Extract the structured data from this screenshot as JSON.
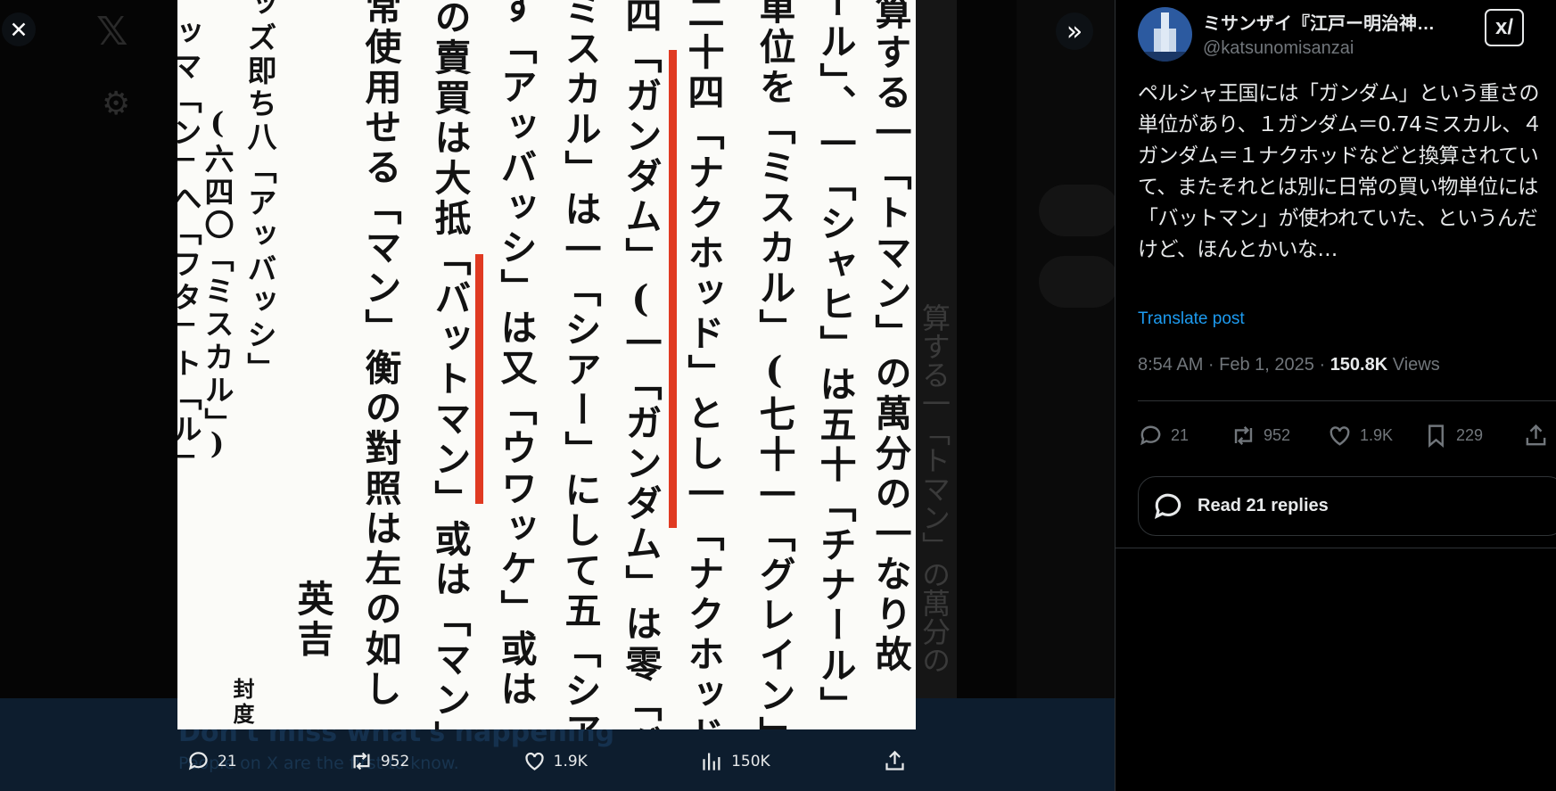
{
  "background_page": {
    "banner_title": "Don't miss what's happening",
    "banner_subtitle": "People on X are the first to know."
  },
  "media": {
    "columns": [
      "算する一「トマン」の萬分の一なり故",
      "ール」、一「シャヒ」は五十「チナール」に",
      "單位を「ミスカル」(七十一「グレイン」)",
      "二十四「ナクホッド」とし一「ナクホッド」",
      "四「ガンダム」(一「ガンダム」は零「グ",
      "ミスカル」は一「シアー」にして五「シア",
      "す「アッバッシ」は又「ウワッケ」或は「カー",
      "の賣買は大抵「バットマン」或は「マン」",
      "常使用せる「マン」衡の對照は左の如し",
      "英吉",
      "ッズ即ち八「アッバッシ」",
      "(六四〇「ミスカル」)",
      "ッマ「ン」へ「フタ」ト「ル」"
    ],
    "footer_small": "封度 六"
  },
  "media_actions": {
    "replies": "21",
    "reposts": "952",
    "likes": "1.9K",
    "views": "150K"
  },
  "post": {
    "display_name": "ミサンザイ『江戸ー明治神…",
    "handle": "@katsunomisanzai",
    "grok_label": "x/",
    "text": "ペルシャ王国には「ガンダム」という重さの単位があり、１ガンダム＝0.74ミスカル、４ガンダム＝１ナクホッドなどと換算されていて、またそれとは別に日常の買い物単位には「バットマン」が使われていた、というんだけど、ほんとかいな…",
    "translate_label": "Translate post",
    "timestamp": "8:54 AM · Feb 1, 2025 · ",
    "views_count": "150.8K",
    "views_label": " Views",
    "stats": {
      "replies": "21",
      "reposts": "952",
      "likes": "1.9K",
      "bookmarks": "229"
    },
    "read_replies_label": "Read 21 replies"
  }
}
